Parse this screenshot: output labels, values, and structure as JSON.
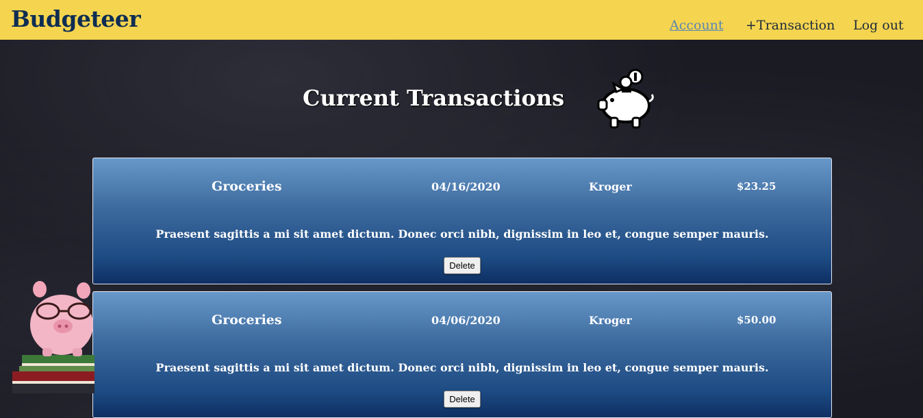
{
  "brand": "Budgeteer",
  "nav": {
    "account": "Account",
    "add_transaction": "+Transaction",
    "logout": "Log out"
  },
  "page": {
    "title": "Current Transactions"
  },
  "transactions": [
    {
      "category": "Groceries",
      "date": "04/16/2020",
      "vendor": "Kroger",
      "amount": "$23.25",
      "description": "Praesent sagittis a mi sit amet dictum. Donec orci nibh, dignissim in leo et, congue semper mauris.",
      "delete_label": "Delete"
    },
    {
      "category": "Groceries",
      "date": "04/06/2020",
      "vendor": "Kroger",
      "amount": "$50.00",
      "description": "Praesent sagittis a mi sit amet dictum. Donec orci nibh, dignissim in leo et, congue semper mauris.",
      "delete_label": "Delete"
    }
  ],
  "colors": {
    "navbar": "#f5d44f",
    "brand": "#0e2d52",
    "active_link": "#5a86b4",
    "card_top": "#6798c9",
    "card_bottom": "#0e2f63",
    "background": "#1b1b24"
  },
  "icons": {
    "title_icon": "piggy-bank-coin-icon",
    "decoration": "piggy-bank-glasses-books-image"
  }
}
